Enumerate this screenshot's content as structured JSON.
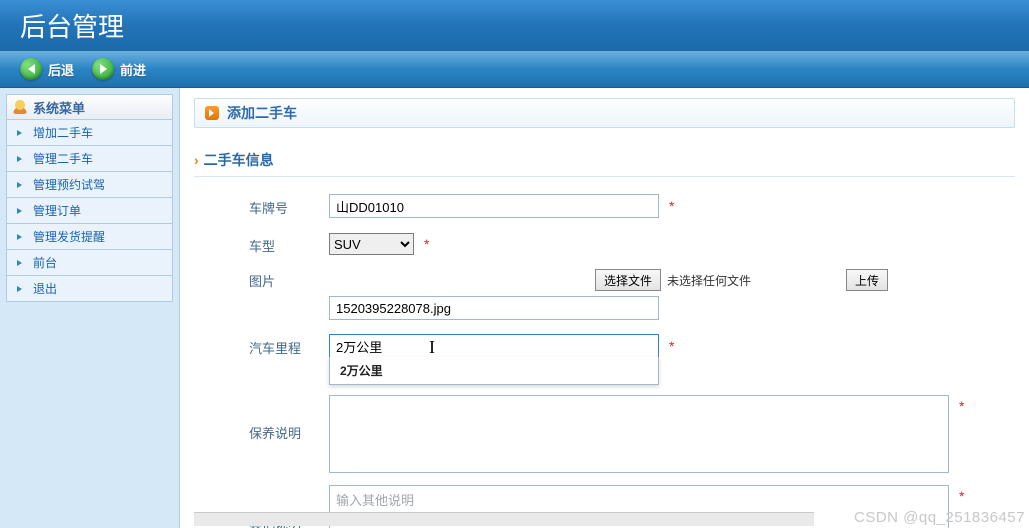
{
  "header": {
    "title": "后台管理"
  },
  "nav": {
    "back": "后退",
    "forward": "前进"
  },
  "sidebar": {
    "header": "系统菜单",
    "items": [
      "增加二手车",
      "管理二手车",
      "管理预约试驾",
      "管理订单",
      "管理发货提醒",
      "前台",
      "退出"
    ]
  },
  "page": {
    "title": "添加二手车",
    "section": "二手车信息"
  },
  "labels": {
    "plate": "车牌号",
    "type": "车型",
    "image": "图片",
    "mileage": "汽车里程",
    "maintenance": "保养说明",
    "other": "其他说明"
  },
  "form": {
    "plate": "山DD01010",
    "type_selected": "SUV",
    "image_name": "1520395228078.jpg",
    "mileage": "2万公里",
    "other_placeholder": "输入其他说明"
  },
  "file": {
    "button": "选择文件",
    "status": "未选择任何文件",
    "upload": "上传"
  },
  "autocomplete": {
    "item0": "2万公里"
  },
  "watermark": "CSDN @qq_251836457"
}
